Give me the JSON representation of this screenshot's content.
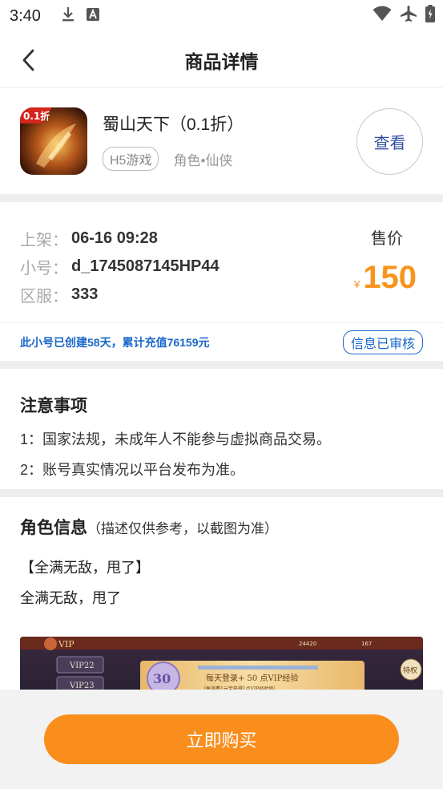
{
  "status_bar": {
    "time": "3:40"
  },
  "nav": {
    "title": "商品详情"
  },
  "product": {
    "name": "蜀山天下（0.1折）",
    "icon_badge": "0.1折",
    "platform_tag": "H5游戏",
    "genre": "角色•仙侠",
    "view_button": "查看"
  },
  "listing": {
    "listed_label": "上架：",
    "listed_value": "06-16 09:28",
    "account_label": "小号：",
    "account_value": "d_1745087145HP44",
    "server_label": "区服：",
    "server_value": "333",
    "price_label": "售价",
    "currency": "¥",
    "price": "150",
    "summary": "此小号已创建58天，累计充值76159元",
    "verified_badge": "信息已审核"
  },
  "notes": {
    "heading": "注意事项",
    "items": [
      "1：国家法规，未成年人不能参与虚拟商品交易。",
      "2：账号真实情况以平台发布为准。"
    ]
  },
  "role": {
    "heading": "角色信息",
    "subheading": "（描述仅供参考，以截图为准）",
    "title": "【全满无敌，甩了】",
    "description": "全满无敌，甩了",
    "screenshot": {
      "vip_label": "VIP",
      "vip_list": [
        "VIP22",
        "VIP23"
      ],
      "vip_level": "30",
      "banner_line1": "每天登录+ 50 点VIP经验",
      "banner_line2": "（每消费1元宝获得1点VIP经验值）",
      "currency1": "24420",
      "currency2": "167",
      "side_label": "特权"
    }
  },
  "buy_button": "立即购买",
  "colors": {
    "accent": "#f98e1d",
    "price": "#f7941d",
    "link_blue": "#1967c8",
    "view_blue": "#3352a0"
  }
}
